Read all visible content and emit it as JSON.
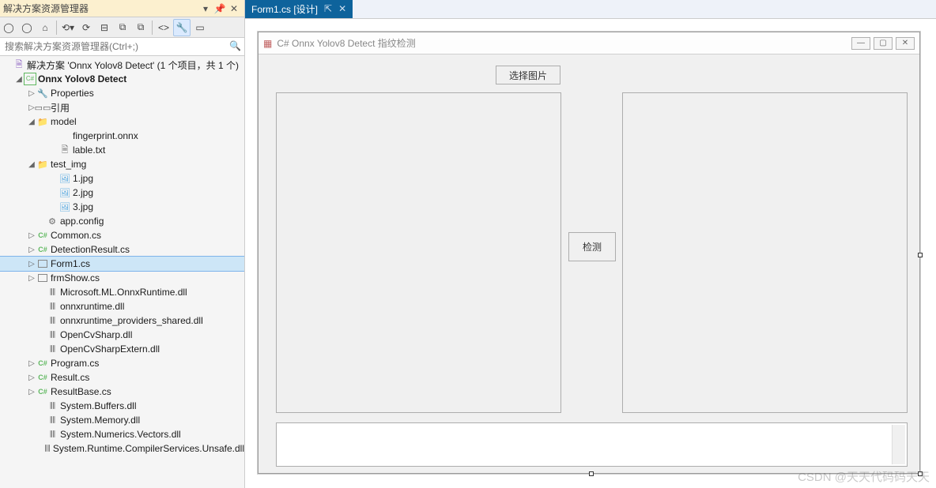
{
  "panel": {
    "title": "解决方案资源管理器",
    "search_placeholder": "搜索解决方案资源管理器(Ctrl+;)"
  },
  "tree": {
    "solution": "解决方案 'Onnx Yolov8 Detect' (1 个项目，共 1 个)",
    "project": "Onnx Yolov8 Detect",
    "properties": "Properties",
    "references": "引用",
    "model": "model",
    "model_files": {
      "fingerprint": "fingerprint.onnx",
      "lable": "lable.txt"
    },
    "test_img": "test_img",
    "test_img_files": {
      "f1": "1.jpg",
      "f2": "2.jpg",
      "f3": "3.jpg"
    },
    "appconfig": "app.config",
    "common": "Common.cs",
    "detectionresult": "DetectionResult.cs",
    "form1": "Form1.cs",
    "frmshow": "frmShow.cs",
    "dll1": "Microsoft.ML.OnnxRuntime.dll",
    "dll2": "onnxruntime.dll",
    "dll3": "onnxruntime_providers_shared.dll",
    "dll4": "OpenCvSharp.dll",
    "dll5": "OpenCvSharpExtern.dll",
    "program": "Program.cs",
    "result": "Result.cs",
    "resultbase": "ResultBase.cs",
    "dll6": "System.Buffers.dll",
    "dll7": "System.Memory.dll",
    "dll8": "System.Numerics.Vectors.dll",
    "dll9": "System.Runtime.CompilerServices.Unsafe.dll"
  },
  "tab": {
    "label": "Form1.cs [设计]"
  },
  "form": {
    "title": "C# Onnx Yolov8 Detect 指纹检测",
    "btn_select": "选择图片",
    "btn_detect": "检测"
  },
  "watermark": "CSDN @天天代码码天天"
}
